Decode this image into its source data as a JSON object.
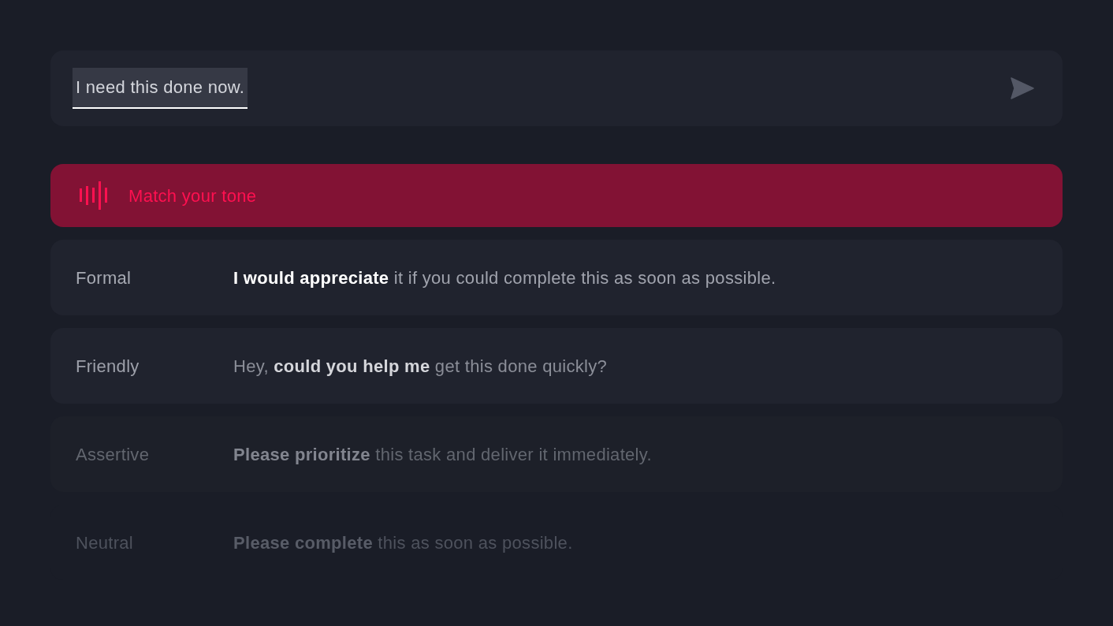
{
  "input": {
    "value": "I need this done now.",
    "text_selected": true
  },
  "header": {
    "title": "Match your tone"
  },
  "tones": [
    {
      "label": "Formal",
      "text": "**I would appreciate** it if you could complete this as soon as possible.",
      "kind": "bright"
    },
    {
      "label": "Friendly",
      "text": "Hey, **could you help me** get this done quickly?",
      "kind": "plain"
    },
    {
      "label": "Assertive",
      "text": "**Please prioritize** this task and deliver it immediately.",
      "kind": "dim"
    },
    {
      "label": "Neutral",
      "text": "**Please complete** this as soon as possible.",
      "kind": "faint"
    }
  ]
}
